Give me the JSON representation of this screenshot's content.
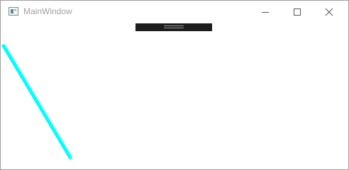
{
  "window": {
    "title": "MainWindow"
  },
  "icons": {
    "app": "app-window-icon",
    "minimize": "minimize-icon",
    "maximize": "maximize-icon",
    "close": "close-icon"
  },
  "colors": {
    "line": "#00ffff",
    "toolbar": "#1d1d1d",
    "title_text": "#a0a0a0"
  }
}
